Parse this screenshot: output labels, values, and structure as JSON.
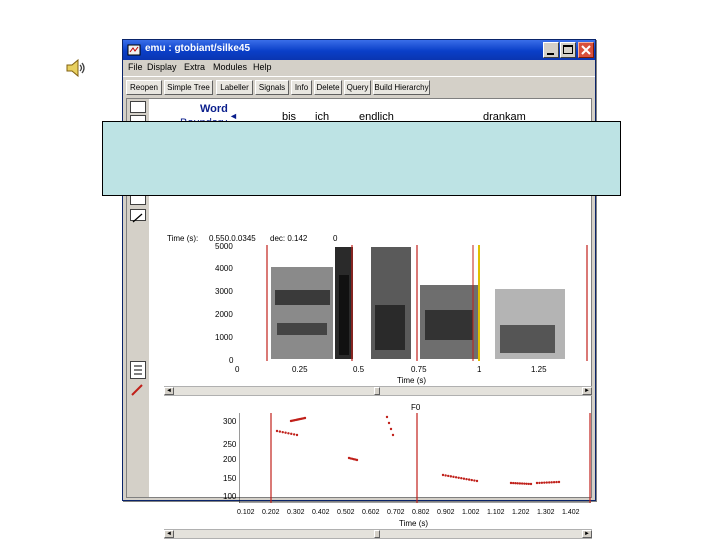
{
  "window": {
    "title": "emu : gtobiant/silke45"
  },
  "menu": [
    "File",
    "Display",
    "Extra",
    "Modules",
    "Help"
  ],
  "toolbar": [
    "Reopen",
    "Simple Tree",
    "Labeller",
    "Signals",
    "Info",
    "Delete",
    "Query",
    "Build Hierarchy"
  ],
  "labels": {
    "word_tier": "Word",
    "boundary": "Boundary",
    "words": [
      "bis",
      "ich",
      "endlich",
      "drankam"
    ]
  },
  "spectrogram": {
    "info_left": "Time (s):",
    "info_mid1": "0.550.0.0345",
    "info_mid2": "dec: 0.142",
    "info_right": "0",
    "y_ticks": [
      "4000",
      "3000",
      "2000",
      "1000",
      "0"
    ],
    "y_top": "5000",
    "x_ticks": [
      "0",
      "0.25",
      "0.5",
      "0.75",
      "1",
      "1.25"
    ],
    "x_label": "Time (s)"
  },
  "f0": {
    "title": "F0",
    "y_ticks": [
      "300",
      "250",
      "200",
      "150",
      "100"
    ],
    "x_ticks": [
      "0.102",
      "0.202",
      "0.302",
      "0.402",
      "0.502",
      "0.602",
      "0.702",
      "0.802",
      "0.902",
      "1.002",
      "1.102",
      "1.202",
      "1.302",
      "1.402"
    ],
    "x_label": "Time (s)"
  },
  "colors": {
    "accent_title": "#0a3fc8",
    "overlay": "#bde3e4",
    "marks": "#c0201a"
  }
}
